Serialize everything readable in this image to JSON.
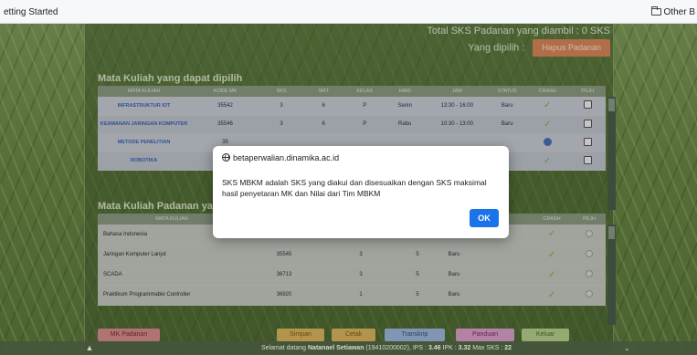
{
  "browser": {
    "bookmark_left": "etting Started",
    "bookmark_right": "Other B"
  },
  "header": {
    "total_label": "Total SKS Padanan yang diambil : 0 SKS",
    "selected_label": "Yang dipilih :",
    "hapus_button": "Hapus Padanan"
  },
  "section1": {
    "title": "Mata Kuliah yang dapat dipilih",
    "columns": [
      "MATA KULIAH",
      "KODE MK",
      "SKS",
      "SMT",
      "KELAS",
      "HARI",
      "JAM",
      "STATUS",
      "CRASH",
      "PILIH"
    ],
    "rows": [
      {
        "mk": "INFRASTRUKTUR IOT",
        "kode": "35542",
        "sks": "3",
        "smt": "6",
        "kelas": "P",
        "hari": "Senin",
        "jam": "13:30 - 16:00",
        "status": "Baru"
      },
      {
        "mk": "KEAMANAN JARINGAN KOMPUTER",
        "kode": "35546",
        "sks": "3",
        "smt": "6",
        "kelas": "P",
        "hari": "Rabu",
        "jam": "10:30 - 13:00",
        "status": "Baru"
      },
      {
        "mk": "METODE PENELITIAN",
        "kode": "35",
        "sks": "",
        "smt": "",
        "kelas": "",
        "hari": "",
        "jam": "",
        "status": ""
      },
      {
        "mk": "ROBOTIKA",
        "kode": "35",
        "sks": "",
        "smt": "",
        "kelas": "",
        "hari": "",
        "jam": "",
        "status": ""
      }
    ]
  },
  "section2": {
    "title": "Mata Kuliah Padanan yang",
    "columns": [
      "MATA KULIAH",
      "",
      "",
      "",
      "",
      "",
      "CRASH",
      "PILIH"
    ],
    "rows": [
      {
        "mk": "Bahasa Indonesia",
        "kode": "12501",
        "sks": "3",
        "smt": "5",
        "status": "Baru"
      },
      {
        "mk": "Jaringan Komputer Lanjut",
        "kode": "35545",
        "sks": "3",
        "smt": "5",
        "status": "Baru"
      },
      {
        "mk": "SCADA",
        "kode": "36713",
        "sks": "3",
        "smt": "5",
        "status": "Baru"
      },
      {
        "mk": "Praktikum Programmable Controller",
        "kode": "36920",
        "sks": "1",
        "smt": "5",
        "status": "Baru"
      }
    ]
  },
  "buttons": {
    "mk_padanan": "MK Padanan",
    "simpan": "Simpan",
    "cetak": "Cetak",
    "transkrip": "Transkrip",
    "panduan": "Panduan",
    "keluar": "Keluar"
  },
  "footer": {
    "welcome": "Selamat datang",
    "name": "Natanael Setiawan",
    "nim": "(19410200002)",
    "ips_label": "IPS :",
    "ips": "3.46",
    "ipk_label": "IPK :",
    "ipk": "3.32",
    "max_sks_label": "Max SKS :",
    "max_sks": "22"
  },
  "dialog": {
    "origin": "betaperwalian.dinamika.ac.id",
    "message": "SKS MBKM adalah SKS yang diakui dan disesuaikan dengan SKS maksimal hasil penyetaran MK dan Nilai dari Tim MBKM",
    "ok_label": "OK"
  },
  "colors": {
    "accent": "#1a73e8",
    "hapus": "#d9875a",
    "check": "#7fae44"
  }
}
